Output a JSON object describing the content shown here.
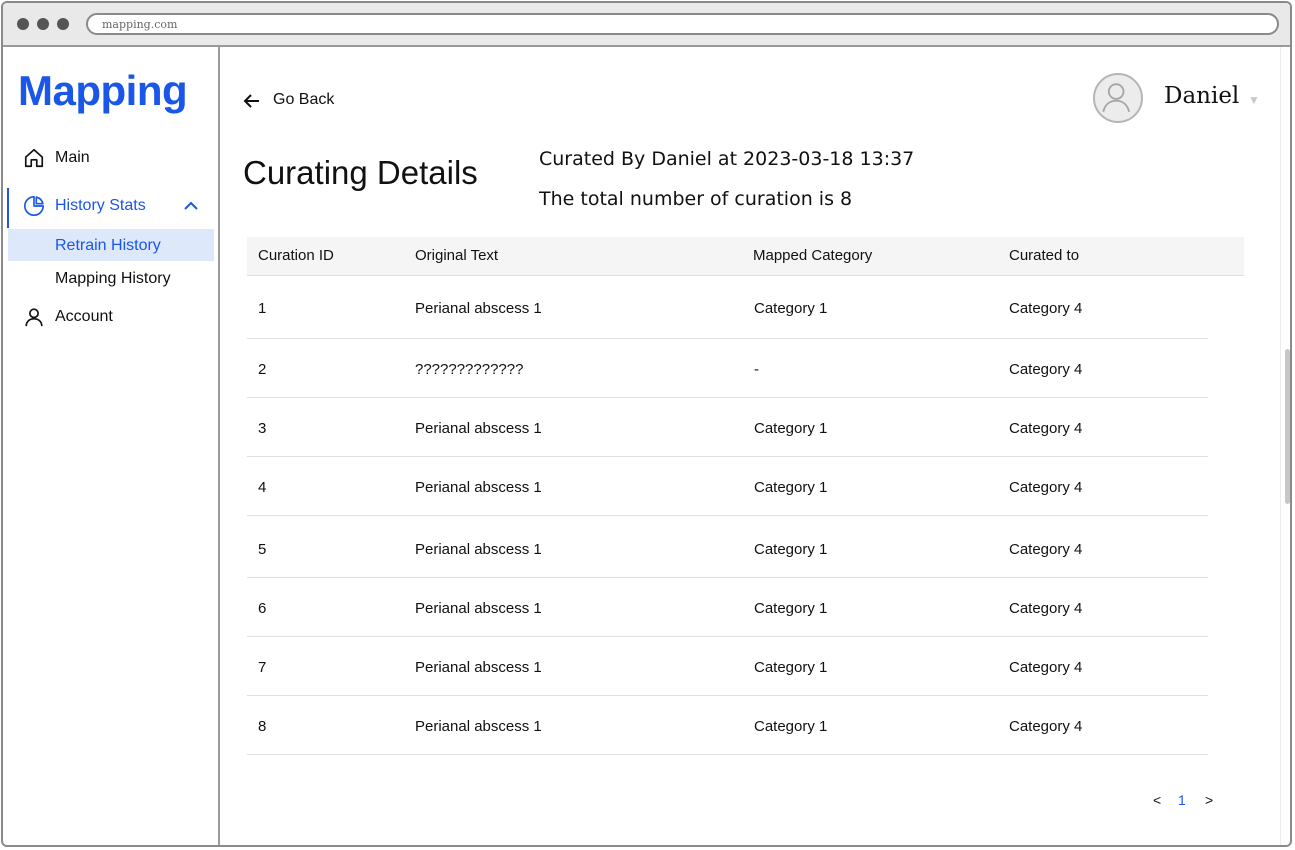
{
  "browser": {
    "url": "mapping.com"
  },
  "sidebar": {
    "logo": "Mapping",
    "items": [
      {
        "label": "Main",
        "icon": "home-icon"
      },
      {
        "label": "History Stats",
        "icon": "pie-chart-icon",
        "expanded": true
      },
      {
        "label": "Account",
        "icon": "user-icon"
      }
    ],
    "sub_items": [
      {
        "label": "Retrain History",
        "selected": true
      },
      {
        "label": "Mapping History",
        "selected": false
      }
    ]
  },
  "header": {
    "go_back": "Go Back",
    "user_name": "Daniel"
  },
  "page": {
    "title": "Curating Details",
    "curated_by": "Curated By Daniel at 2023-03-18 13:37",
    "total": "The total number of curation is 8"
  },
  "table": {
    "columns": [
      "Curation ID",
      "Original Text",
      "Mapped Category",
      "Curated to"
    ],
    "rows": [
      [
        "1",
        "Perianal abscess 1",
        "Category 1",
        "Category 4"
      ],
      [
        "2",
        "?????????????",
        "-",
        "Category 4"
      ],
      [
        "3",
        "Perianal abscess 1",
        "Category 1",
        "Category 4"
      ],
      [
        "4",
        "Perianal abscess 1",
        "Category 1",
        "Category 4"
      ],
      [
        "5",
        "Perianal abscess 1",
        "Category 1",
        "Category 4"
      ],
      [
        "6",
        "Perianal abscess 1",
        "Category 1",
        "Category 4"
      ],
      [
        "7",
        "Perianal abscess 1",
        "Category 1",
        "Category 4"
      ],
      [
        "8",
        "Perianal abscess 1",
        "Category 1",
        "Category 4"
      ]
    ]
  },
  "pagination": {
    "prev": "<",
    "current": "1",
    "next": ">"
  },
  "colors": {
    "accent": "#1a56e8",
    "selected_bg": "#dde8fb"
  }
}
